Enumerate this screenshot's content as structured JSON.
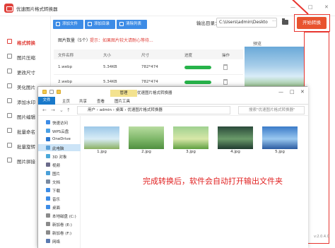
{
  "app": {
    "title": "优速图片格式转换器",
    "win_controls": [
      "—",
      "□",
      "✕"
    ],
    "version": "v:2.0.4.0"
  },
  "sidebar": {
    "items": [
      {
        "label": "格式转换",
        "active": true
      },
      {
        "label": "图片压缩"
      },
      {
        "label": "更改尺寸"
      },
      {
        "label": "美化图片"
      },
      {
        "label": "添加水印"
      },
      {
        "label": "图片编辑"
      },
      {
        "label": "批量命名"
      },
      {
        "label": "批量旋转"
      },
      {
        "label": "图片拼接"
      }
    ]
  },
  "toolbar": {
    "add_file": "添加文件",
    "add_dir": "添加目录",
    "clear_list": "清除列表",
    "output_label": "输出目录：",
    "output_path": "C:\\Users\\admin\\Deskto",
    "output_more": "···",
    "start": "开始转换"
  },
  "notice": {
    "count_text": "图片数量（5个）",
    "hint": "提示：如果图片较大请耐心等待..."
  },
  "table": {
    "headers": [
      "文件名称",
      "大小",
      "尺寸",
      "进度",
      "操作"
    ],
    "rows": [
      {
        "name": "1.webp",
        "size": "5.34KB",
        "dims": "782*474",
        "progress": 1.0
      },
      {
        "name": "2.webp",
        "size": "5.34KB",
        "dims": "782*474",
        "progress": 1.0
      }
    ]
  },
  "preview": {
    "label": "预览"
  },
  "explorer": {
    "title": "优速图片格式转换器",
    "manage_tab": "管理",
    "ribbon_tabs": [
      "文件",
      "主页",
      "共享",
      "查看",
      "图片工具"
    ],
    "address": [
      "用户",
      "admin",
      "桌面",
      "优速图片格式转换器"
    ],
    "search_placeholder": "搜索\"优速图片格式转换器\"",
    "nav": [
      {
        "label": "快速访问",
        "icon": "star-icon",
        "color": "#3d8ce6"
      },
      {
        "label": "WPS云盘",
        "icon": "cloud-icon",
        "color": "#4aa0e6"
      },
      {
        "label": "OneDrive",
        "icon": "cloud-icon",
        "color": "#2b78d0"
      },
      {
        "label": "此电脑",
        "icon": "computer-icon",
        "color": "#5aa0d8",
        "selected": true
      },
      {
        "label": "3D 对象",
        "icon": "cube-icon",
        "color": "#4aa8d8"
      },
      {
        "label": "视频",
        "icon": "video-icon",
        "color": "#6a6a8a"
      },
      {
        "label": "图片",
        "icon": "picture-icon",
        "color": "#4aa0d8"
      },
      {
        "label": "文档",
        "icon": "document-icon",
        "color": "#7a8aa0"
      },
      {
        "label": "下载",
        "icon": "download-icon",
        "color": "#3d8ce6"
      },
      {
        "label": "音乐",
        "icon": "music-icon",
        "color": "#3d8ce6"
      },
      {
        "label": "桌面",
        "icon": "desktop-icon",
        "color": "#3d8ce6"
      },
      {
        "label": "本地磁盘 (C:)",
        "icon": "drive-icon",
        "color": "#8a8a8a"
      },
      {
        "label": "新加卷 (E:)",
        "icon": "drive-icon",
        "color": "#8a8a8a"
      },
      {
        "label": "新加卷 (F:)",
        "icon": "drive-icon",
        "color": "#8a8a8a"
      },
      {
        "label": "网络",
        "icon": "network-icon",
        "color": "#5a7ab0"
      }
    ],
    "files": [
      {
        "name": "1.jpg",
        "colors": [
          "#9cc8e8",
          "#d8ecf6",
          "#8ab060"
        ]
      },
      {
        "name": "2.jpg",
        "colors": [
          "#b8dca0",
          "#7fb86a",
          "#4f8f40"
        ]
      },
      {
        "name": "3.jpg",
        "colors": [
          "#9fd090",
          "#d8e8a8",
          "#5fa040"
        ]
      },
      {
        "name": "4.jpg",
        "colors": [
          "#2a4a3a",
          "#6a9a6a",
          "#1f3a2f"
        ]
      },
      {
        "name": "5.jpg",
        "colors": [
          "#3a7ac8",
          "#9ac8f0",
          "#2a5aa0"
        ]
      }
    ],
    "caption": "完成转换后，软件会自动打开输出文件夹"
  }
}
